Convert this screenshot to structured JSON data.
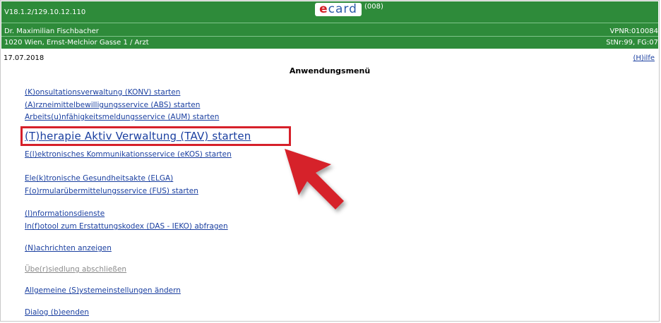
{
  "header": {
    "version": "V18.1.2/129.10.12.110",
    "doctor": "Dr. Maximilian Fischbacher",
    "address": "1020 Wien, Ernst-Melchior Gasse 1 / Arzt",
    "vpnr": "VPNR:010084",
    "stnr": "StNr:99, FG:07",
    "logo_text": "card",
    "logo_e": "e",
    "count": "(008)",
    "bg_color": "#2e8b3a"
  },
  "date": "17.07.2018",
  "help": "(H)ilfe",
  "title": "Anwendungsmenü",
  "menu": [
    "(K)onsultationsverwaltung (KONV) starten",
    "(A)rzneimittelbewilligungsservice (ABS) starten",
    "Arbeits(u)nfähigkeitsmeldungsservice (AUM) starten",
    "(T)herapie Aktiv Verwaltung (TAV) starten",
    "E(l)ektronisches Kommunikationsservice (eKOS) starten",
    "Ele(k)tronische Gesundheitsakte (ELGA)",
    "F(o)rmularübermittelungsservice (FUS) starten",
    "(I)nformationsdienste",
    "In(f)otool zum Erstattungskodex (DAS - IEKO) abfragen",
    "(N)achrichten anzeigen",
    "Übe(r)siedlung abschließen",
    "Allgemeine (S)ystemeinstellungen ändern",
    "Dialog (b)eenden"
  ],
  "highlight_color": "#d6202a"
}
